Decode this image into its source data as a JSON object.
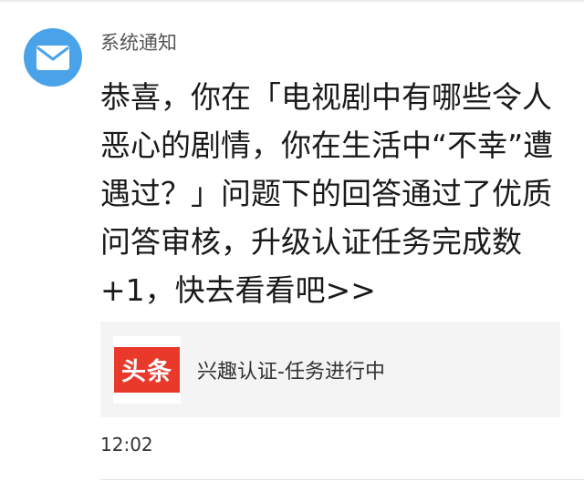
{
  "notification": {
    "sender": "系统通知",
    "icon": "mail-icon",
    "avatar_color": "#4aa3e8",
    "message": "恭喜，你在「电视剧中有哪些令人恶心的剧情，你在生活中“不幸”遭遇过？」问题下的回答通过了优质问答审核，升级认证任务完成数+1，快去看看吧>>",
    "card": {
      "logo_text": "头条",
      "logo_color": "#e8392b",
      "title": "兴趣认证-任务进行中"
    },
    "time": "12:02"
  }
}
